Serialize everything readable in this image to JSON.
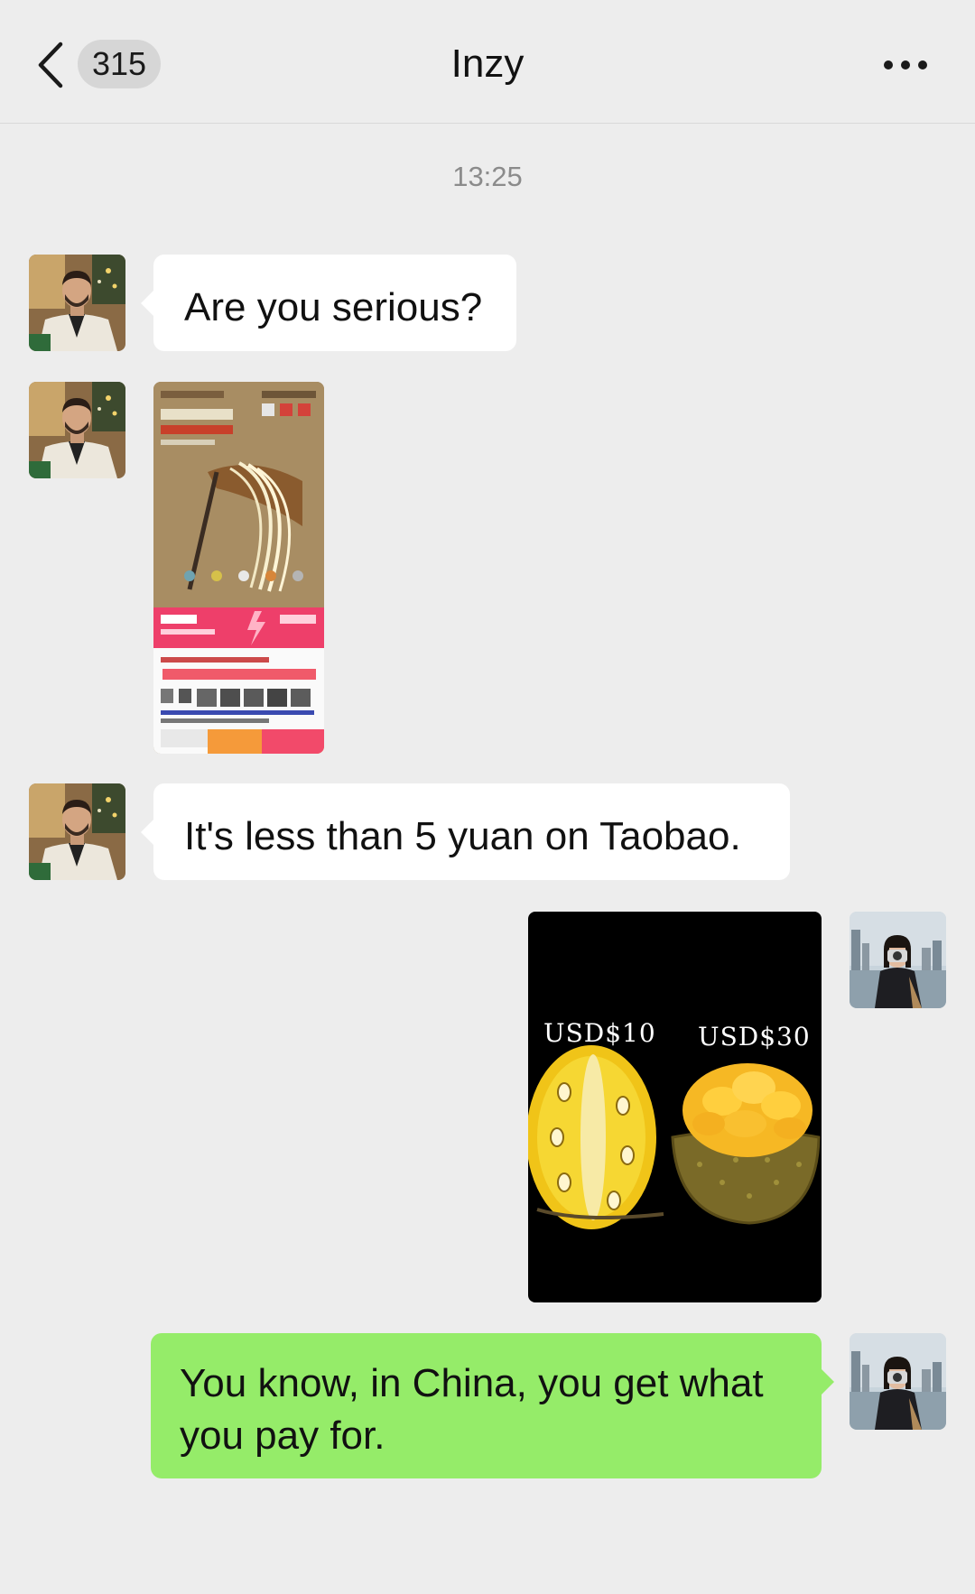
{
  "header": {
    "back_icon": "chevron-left-icon",
    "unread_count": "315",
    "title": "Inzy",
    "more_icon": "more-dots-icon"
  },
  "chat": {
    "timestamp": "13:25",
    "messages": [
      {
        "sender": "contact",
        "type": "text",
        "text": "Are you serious?"
      },
      {
        "sender": "contact",
        "type": "image",
        "image": "taobao-product-screenshot"
      },
      {
        "sender": "contact",
        "type": "text",
        "text": "It's less than 5 yuan on Taobao."
      },
      {
        "sender": "self",
        "type": "image",
        "image": "jackfruit-price-comparison",
        "labels": [
          "USD$10",
          "USD$30"
        ]
      },
      {
        "sender": "self",
        "type": "text",
        "text": "You know, in China, you get what you pay for."
      }
    ]
  },
  "colors": {
    "background": "#ededed",
    "incoming_bubble": "#ffffff",
    "outgoing_bubble": "#95ec69"
  }
}
